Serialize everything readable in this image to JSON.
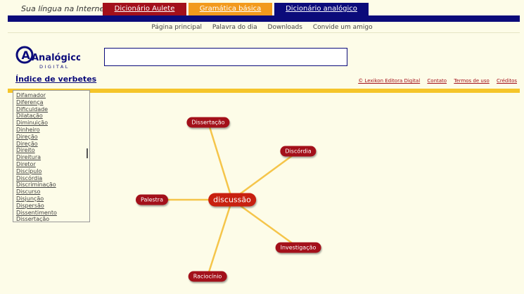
{
  "header": {
    "tagline": "Sua língua na Internet",
    "tabs": [
      "Dicionário Aulete",
      "Gramática básica",
      "Dicionário analógico"
    ]
  },
  "subnav": [
    "Página principal",
    "Palavra do dia",
    "Downloads",
    "Convide um amigo"
  ],
  "logo": {
    "big": "Analógico",
    "small": "DIGITAL"
  },
  "search": {
    "value": "",
    "placeholder": ""
  },
  "index_title": "Índice de verbetes",
  "footer_links": [
    "© Lexikon Editora Digital",
    "Contato",
    "Termos de uso",
    "Créditos"
  ],
  "verbs": [
    "Difamador",
    "Diferença",
    "Dificuldade",
    "Dilatação",
    "Diminuição",
    "Dinheiro",
    "Direção",
    "Direção",
    "Direito",
    "Direitura",
    "Diretor",
    "Discípulo",
    "Discórdia",
    "Discriminação",
    "Discurso",
    "Disjunção",
    "Dispersão",
    "Dissentimento",
    "Dissertação"
  ],
  "graph": {
    "center": "discussão",
    "nodes": [
      "Dissertação",
      "Discórdia",
      "Palestra",
      "Investigação",
      "Raciocínio"
    ]
  },
  "colors": {
    "navy": "#0b0b7a",
    "red": "#a3101a",
    "orange": "#f29a1c",
    "yellow": "#f5c52a",
    "background": "#fdfce8"
  }
}
